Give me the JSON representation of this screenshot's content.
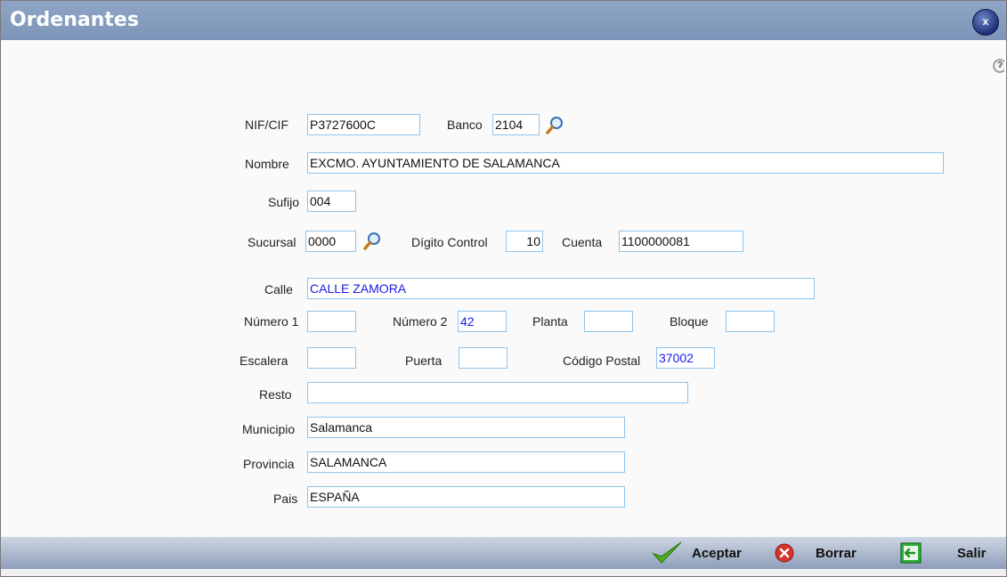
{
  "window": {
    "title": "Ordenantes",
    "close_label": "x"
  },
  "form": {
    "nif": {
      "label": "NIF/CIF",
      "value": "P3727600C"
    },
    "banco": {
      "label": "Banco",
      "value": "2104"
    },
    "nombre": {
      "label": "Nombre",
      "value": "EXCMO. AYUNTAMIENTO DE SALAMANCA"
    },
    "sufijo": {
      "label": "Sufijo",
      "value": "004"
    },
    "sucursal": {
      "label": "Sucursal",
      "value": "0000"
    },
    "digito": {
      "label": "Dígito Control",
      "value": "10"
    },
    "cuenta": {
      "label": "Cuenta",
      "value": "1100000081"
    },
    "calle": {
      "label": "Calle",
      "value": "CALLE ZAMORA"
    },
    "numero1": {
      "label": "Número 1",
      "value": ""
    },
    "numero2": {
      "label": "Número 2",
      "value": "42"
    },
    "planta": {
      "label": "Planta",
      "value": ""
    },
    "bloque": {
      "label": "Bloque",
      "value": ""
    },
    "escalera": {
      "label": "Escalera",
      "value": ""
    },
    "puerta": {
      "label": "Puerta",
      "value": ""
    },
    "codigo_postal": {
      "label": "Código Postal",
      "value": "37002"
    },
    "resto": {
      "label": "Resto",
      "value": ""
    },
    "municipio": {
      "label": "Municipio",
      "value": "Salamanca"
    },
    "provincia": {
      "label": "Provincia",
      "value": "SALAMANCA"
    },
    "pais": {
      "label": "Pais",
      "value": "ESPAÑA"
    }
  },
  "footer": {
    "accept": "Aceptar",
    "delete": "Borrar",
    "exit": "Salir"
  },
  "icons": {
    "search": "magnifier-icon",
    "accept": "checkmark-icon",
    "delete": "red-x-icon",
    "exit": "exit-door-icon",
    "help": "help-icon",
    "close": "close-icon"
  },
  "colors": {
    "titlebar": "#8fa5c6",
    "input_border": "#8fc4ec",
    "value_blue": "#1a1ae6"
  }
}
